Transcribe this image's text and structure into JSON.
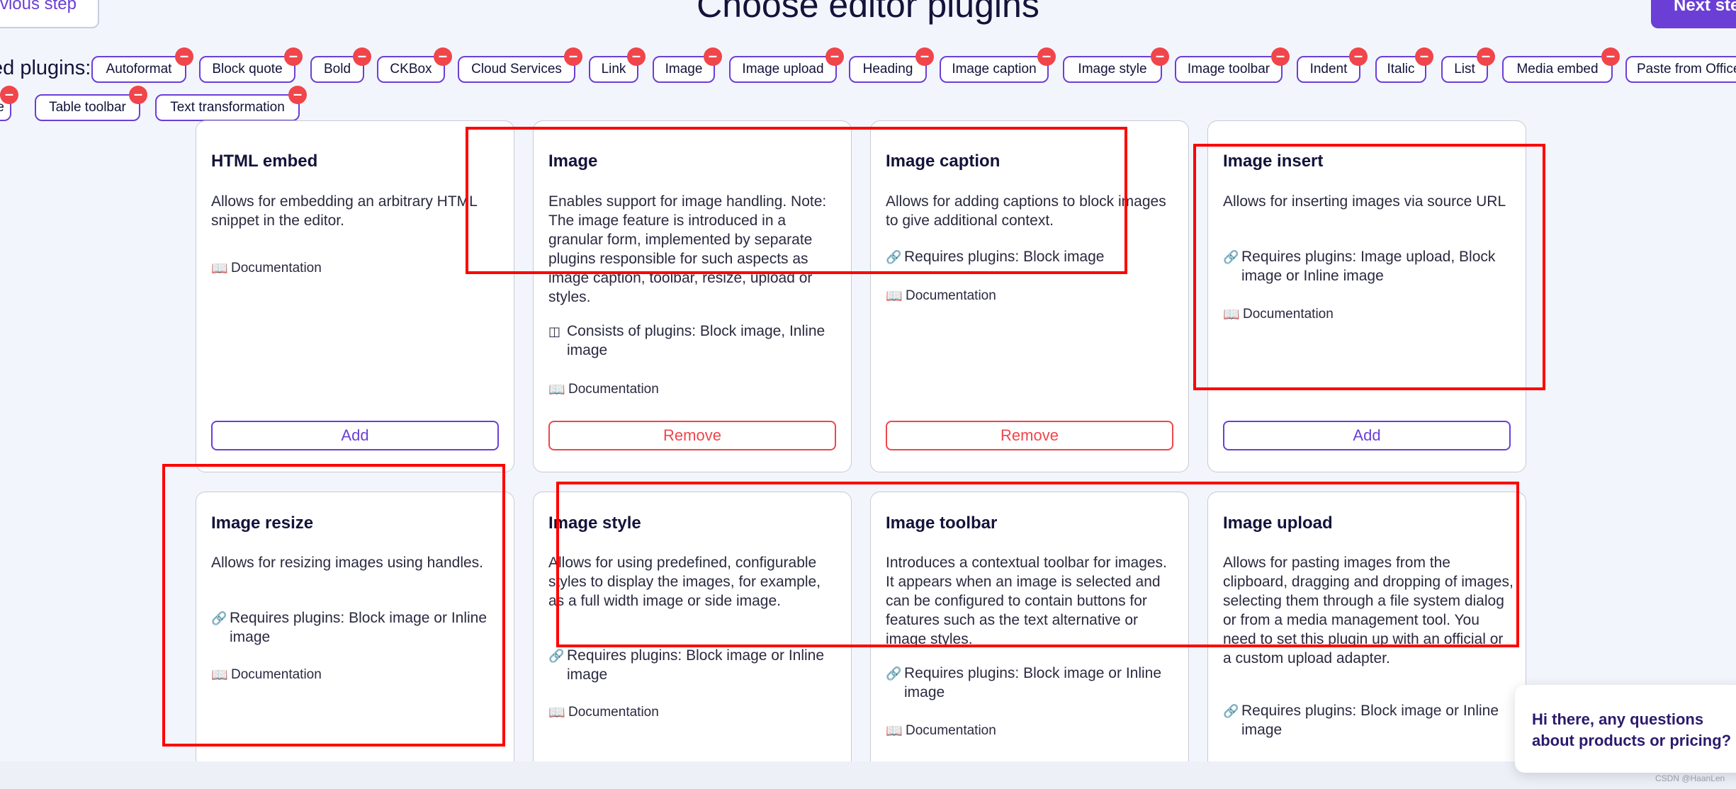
{
  "nav": {
    "prev_label": "evious step",
    "next_label": "Next step",
    "title": "Choose editor plugins"
  },
  "selected": {
    "label": "ed plugins:",
    "remove_glyph": "–",
    "chips": [
      "Autoformat",
      "Block quote",
      "Bold",
      "CKBox",
      "Cloud Services",
      "Link",
      "Image",
      "Image upload",
      "Heading",
      "Image caption",
      "Image style",
      "Image toolbar",
      "Indent",
      "Italic",
      "List",
      "Media embed",
      "Paste from Office",
      "e",
      "Table toolbar",
      "Text transformation"
    ]
  },
  "cards": [
    {
      "title": "HTML embed",
      "desc": "Allows for embedding an arbitrary HTML snippet in the editor.",
      "meta": "",
      "meta_icon": "",
      "doc": "Documentation",
      "action": "Add"
    },
    {
      "title": "Image",
      "desc": "Enables support for image handling. Note: The image feature is introduced in a granular form, implemented by separate plugins responsible for such aspects as image caption, toolbar, resize, upload or styles.",
      "meta": "Consists of plugins: Block image, Inline image",
      "meta_icon": "archive-icon",
      "doc": "Documentation",
      "action": "Remove"
    },
    {
      "title": "Image caption",
      "desc": "Allows for adding captions to block images to give additional context.",
      "meta": "Requires plugins: Block image",
      "meta_icon": "link-icon",
      "doc": "Documentation",
      "action": "Remove"
    },
    {
      "title": "Image insert",
      "desc": "Allows for inserting images via source URL",
      "meta": "Requires plugins: Image upload, Block image or Inline image",
      "meta_icon": "link-icon",
      "doc": "Documentation",
      "action": "Add"
    },
    {
      "title": "Image resize",
      "desc": "Allows for resizing images using handles.",
      "meta": "Requires plugins: Block image or Inline image",
      "meta_icon": "link-icon",
      "doc": "Documentation",
      "action": ""
    },
    {
      "title": "Image style",
      "desc": "Allows for using predefined, configurable styles to display the images, for example, as a full width image or side image.",
      "meta": "Requires plugins: Block image or Inline image",
      "meta_icon": "link-icon",
      "doc": "Documentation",
      "action": ""
    },
    {
      "title": "Image toolbar",
      "desc": "Introduces a contextual toolbar for images. It appears when an image is selected and can be configured to contain buttons for features such as the text alternative or image styles.",
      "meta": "Requires plugins: Block image or Inline image",
      "meta_icon": "link-icon",
      "doc": "Documentation",
      "action": ""
    },
    {
      "title": "Image upload",
      "desc": "Allows for pasting images from the clipboard, dragging and dropping of images, selecting them through a file system dialog or from a media management tool. You need to set this plugin up with an official or a custom upload adapter.",
      "meta": "Requires plugins: Block image or Inline image",
      "meta_icon": "link-icon",
      "doc": "",
      "action": ""
    }
  ],
  "chat": {
    "text": "Hi there, any questions about products or pricing?"
  },
  "watermark": "CSDN @HaanLen",
  "colors": {
    "accent": "#6b3fd6",
    "remove": "#f0454a",
    "annotation": "#ff0000"
  }
}
